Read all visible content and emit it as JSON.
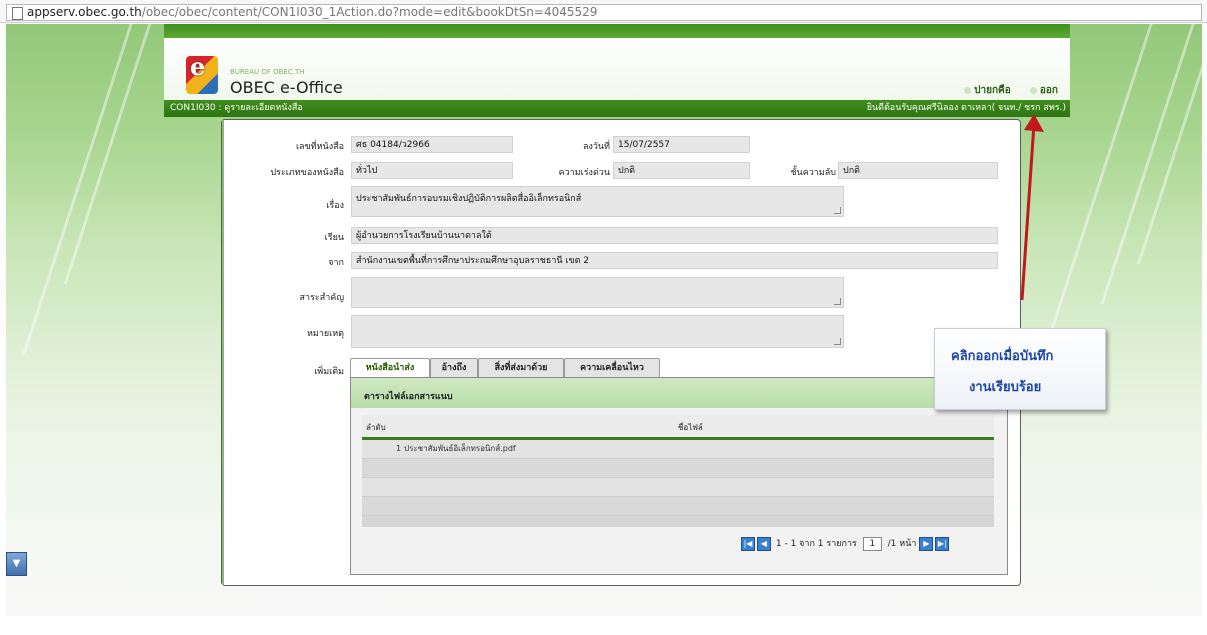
{
  "browser": {
    "url_host": "appserv.obec.go.th",
    "url_path": "/obec/obec/content/CON1I030_1Action.do?mode=edit&bookDtSn=4045529"
  },
  "header": {
    "sub_brand": "BUREAU OF OBEC.TH",
    "brand": "OBEC e-Office",
    "links": [
      "ปายกคือ",
      "ออก"
    ]
  },
  "statusbar": {
    "left": "CON1I030 : ดูรายละเอียดหนังสือ",
    "right": "ยินดีต้อนรับคุณศรีนิลอง ดาเหลา( จนท./ ชรก สพร.)"
  },
  "form": {
    "labels": {
      "doc_no": "เลขที่หนังสือ",
      "date": "ลงวันที่",
      "doc_type": "ประเภทของหนังสือ",
      "urgency": "ความเร่งด่วน",
      "secrecy": "ชั้นความลับ",
      "subject": "เรื่อง",
      "to": "เรียน",
      "from": "จาก",
      "summary": "สาระสำคัญ",
      "note": "หมายเหตุ",
      "more": "เพิ่มเติม"
    },
    "values": {
      "doc_no": "ศธ 04184/ว2966",
      "date": "15/07/2557",
      "doc_type": "ทั่วไป",
      "urgency": "ปกติ",
      "secrecy": "ปกติ",
      "subject": "ประชาสัมพันธ์การอบรมเชิงปฏิบัติการผลิตสื่ออิเล็กทรอนิกส์",
      "to": "ผู้อำนวยการโรงเรียนบ้านนาดาลใต้",
      "from": "สำนักงานเขตพื้นที่การศึกษาประถมศึกษาอุบลราชธานี เขต 2",
      "summary": "",
      "note": ""
    }
  },
  "tabs": [
    "หนังสือนำส่ง",
    "อ้างถึง",
    "สิ่งที่ส่งมาด้วย",
    "ความเคลื่อนไหว"
  ],
  "files": {
    "caption": "ตารางไฟล์เอกสารแนบ",
    "col_index": "ลำดับ",
    "col_name": "ชื่อไฟล์",
    "rows": [
      {
        "index": "1",
        "name": "ประชาสัมพันธ์อิเล็กทรอนิกส์.pdf"
      }
    ],
    "pager": {
      "summary": "1 - 1 จาก 1 รายการ",
      "page": "1",
      "of_pages": "/1 หน้า"
    }
  },
  "callout": {
    "line1": "คลิกออกเมื่อบันทึก",
    "line2": "งานเรียบร้อย"
  },
  "colors": {
    "header_green": "#3f8e1c",
    "arrow_red": "#c0181b",
    "callout_text": "#1f45a6"
  }
}
